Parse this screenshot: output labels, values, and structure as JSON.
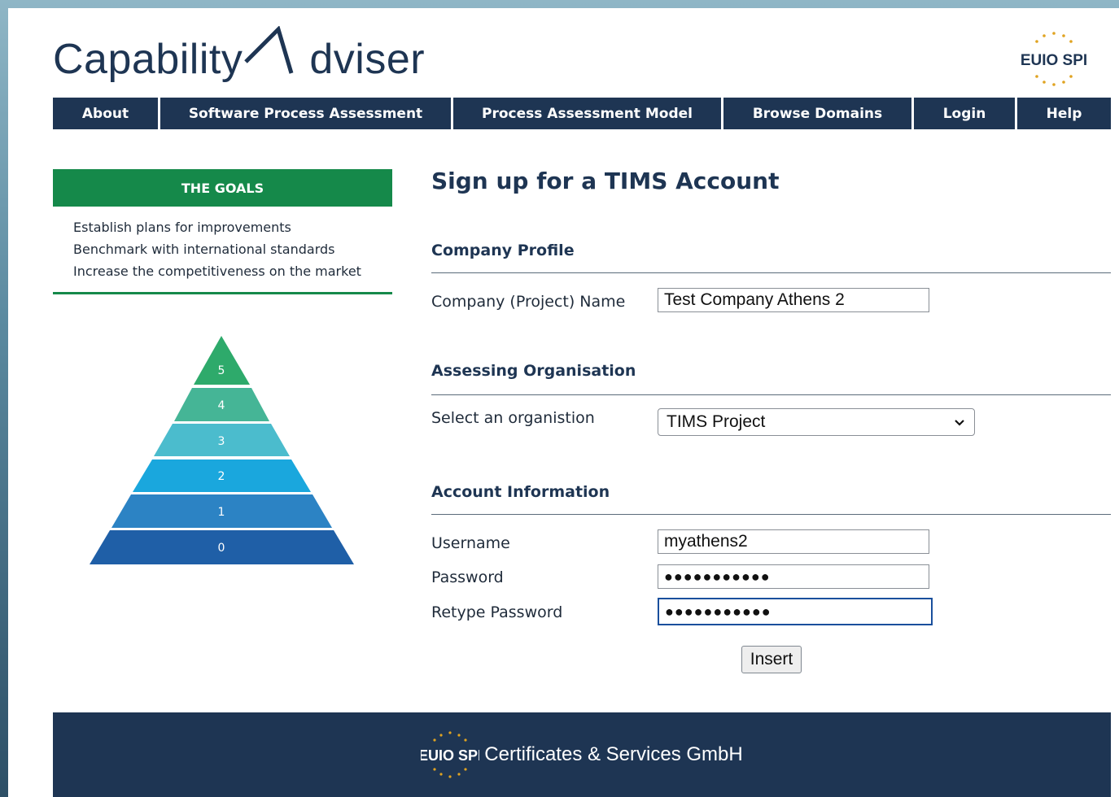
{
  "header": {
    "logo_left": "Capability",
    "logo_right": "dviser",
    "partner_logo": "EUIO SPI"
  },
  "nav": {
    "items": [
      {
        "label": "About"
      },
      {
        "label": "Software Process Assessment"
      },
      {
        "label": "Process Assessment Model"
      },
      {
        "label": "Browse Domains"
      },
      {
        "label": "Login"
      },
      {
        "label": "Help"
      }
    ]
  },
  "sidebar": {
    "goals_title": "THE GOALS",
    "goals": [
      "Establish plans for improvements",
      "Benchmark with international standards",
      "Increase the competitiveness on the market"
    ],
    "pyramid_levels": [
      {
        "label": "5",
        "color": "#2eaa6b"
      },
      {
        "label": "4",
        "color": "#45b596"
      },
      {
        "label": "3",
        "color": "#4bbccd"
      },
      {
        "label": "2",
        "color": "#1aa7dd"
      },
      {
        "label": "1",
        "color": "#2c83c4"
      },
      {
        "label": "0",
        "color": "#1f5fa7"
      }
    ]
  },
  "form": {
    "title": "Sign up for a TIMS Account",
    "company_profile": {
      "heading": "Company Profile",
      "name_label": "Company (Project) Name",
      "name_value": "Test Company Athens 2"
    },
    "assessing_org": {
      "heading": "Assessing Organisation",
      "select_label": "Select an organistion",
      "selected": "TIMS Project"
    },
    "account": {
      "heading": "Account Information",
      "username_label": "Username",
      "username_value": "myathens2",
      "password_label": "Password",
      "password_value": "●●●●●●●●●●●",
      "retype_label": "Retype Password",
      "retype_value": "●●●●●●●●●●●"
    },
    "submit_label": "Insert"
  },
  "footer": {
    "logo": "EUIO SPI",
    "text": "Certificates & Services GmbH"
  },
  "colors": {
    "navy": "#1e3553",
    "green": "#15894a"
  }
}
